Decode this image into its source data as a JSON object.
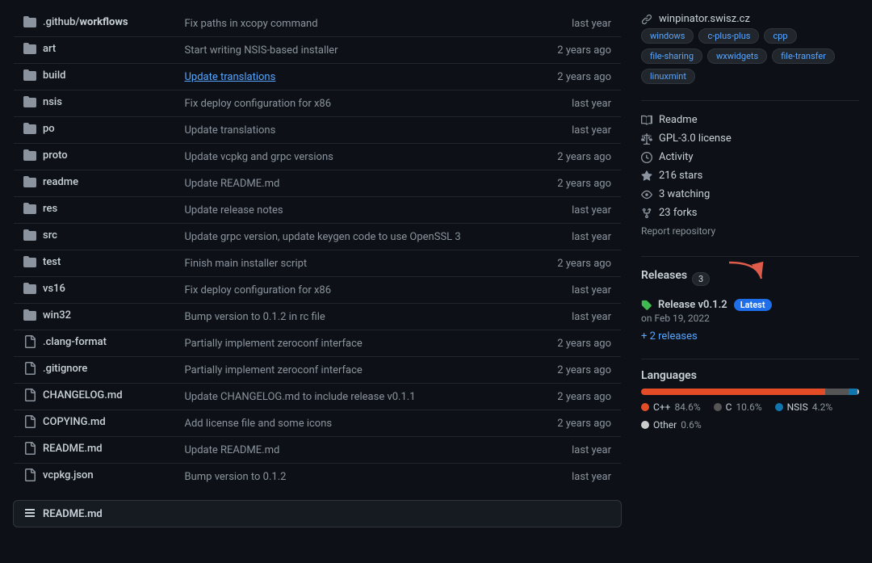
{
  "sidebar": {
    "website": "winpinator.swisz.cz",
    "tags": [
      "windows",
      "c-plus-plus",
      "cpp",
      "file-sharing",
      "wxwidgets",
      "file-transfer",
      "linuxmint"
    ],
    "readme_label": "Readme",
    "license_label": "GPL-3.0 license",
    "activity_label": "Activity",
    "stars_count": "216",
    "stars_label": "stars",
    "watching_count": "3",
    "watching_label": "watching",
    "forks_count": "23",
    "forks_label": "forks",
    "report_label": "Report repository",
    "releases_title": "Releases",
    "releases_count": "3",
    "release_name": "Release v0.1.2",
    "release_badge": "Latest",
    "release_date": "on Feb 19, 2022",
    "more_releases": "+ 2 releases",
    "languages_title": "Languages",
    "languages": [
      {
        "name": "C++",
        "pct": "84.6%",
        "color": "#e34c26",
        "width": "84.6"
      },
      {
        "name": "C",
        "pct": "10.6%",
        "color": "#555555",
        "width": "10.6"
      },
      {
        "name": "NSIS",
        "pct": "4.2%",
        "color": "#1176b0",
        "width": "4.2"
      },
      {
        "name": "Other",
        "pct": "0.6%",
        "color": "#cccccc",
        "width": "0.6"
      }
    ]
  },
  "files": [
    {
      "type": "folder",
      "name": ".github/workflows",
      "bold": "workflows",
      "prefix": ".github/",
      "commit": "Fix paths in xcopy command",
      "time": "last year"
    },
    {
      "type": "folder",
      "name": "art",
      "bold": "art",
      "prefix": "",
      "commit": "Start writing NSIS-based installer",
      "time": "2 years ago"
    },
    {
      "type": "folder",
      "name": "build",
      "bold": "build",
      "prefix": "",
      "commit": "Update translations",
      "time": "2 years ago",
      "commit_link": true
    },
    {
      "type": "folder",
      "name": "nsis",
      "bold": "nsis",
      "prefix": "",
      "commit": "Fix deploy configuration for x86",
      "time": "last year"
    },
    {
      "type": "folder",
      "name": "po",
      "bold": "po",
      "prefix": "",
      "commit": "Update translations",
      "time": "last year"
    },
    {
      "type": "folder",
      "name": "proto",
      "bold": "proto",
      "prefix": "",
      "commit": "Update vcpkg and grpc versions",
      "time": "2 years ago"
    },
    {
      "type": "folder",
      "name": "readme",
      "bold": "readme",
      "prefix": "",
      "commit": "Update README.md",
      "time": "2 years ago"
    },
    {
      "type": "folder",
      "name": "res",
      "bold": "res",
      "prefix": "",
      "commit": "Update release notes",
      "time": "last year"
    },
    {
      "type": "folder",
      "name": "src",
      "bold": "src",
      "prefix": "",
      "commit": "Update grpc version, update keygen code to use OpenSSL 3",
      "time": "last year"
    },
    {
      "type": "folder",
      "name": "test",
      "bold": "test",
      "prefix": "",
      "commit": "Finish main installer script",
      "time": "2 years ago"
    },
    {
      "type": "folder",
      "name": "vs16",
      "bold": "vs16",
      "prefix": "",
      "commit": "Fix deploy configuration for x86",
      "time": "last year"
    },
    {
      "type": "folder",
      "name": "win32",
      "bold": "win32",
      "prefix": "",
      "commit": "Bump version to 0.1.2 in rc file",
      "time": "last year"
    },
    {
      "type": "file",
      "name": ".clang-format",
      "bold": ".clang-format",
      "prefix": "",
      "commit": "Partially implement zeroconf interface",
      "time": "2 years ago"
    },
    {
      "type": "file",
      "name": ".gitignore",
      "bold": ".gitignore",
      "prefix": "",
      "commit": "Partially implement zeroconf interface",
      "time": "2 years ago"
    },
    {
      "type": "file",
      "name": "CHANGELOG.md",
      "bold": "CHANGELOG.md",
      "prefix": "",
      "commit": "Update CHANGELOG.md to include release v0.1.1",
      "time": "2 years ago"
    },
    {
      "type": "file",
      "name": "COPYING.md",
      "bold": "COPYING.md",
      "prefix": "",
      "commit": "Add license file and some icons",
      "time": "2 years ago"
    },
    {
      "type": "file",
      "name": "README.md",
      "bold": "README.md",
      "prefix": "",
      "commit": "Update README.md",
      "time": "last year"
    },
    {
      "type": "file",
      "name": "vcpkg.json",
      "bold": "vcpkg.json",
      "prefix": "",
      "commit": "Bump version to 0.1.2",
      "time": "last year"
    }
  ],
  "readme_bar_label": "README.md"
}
